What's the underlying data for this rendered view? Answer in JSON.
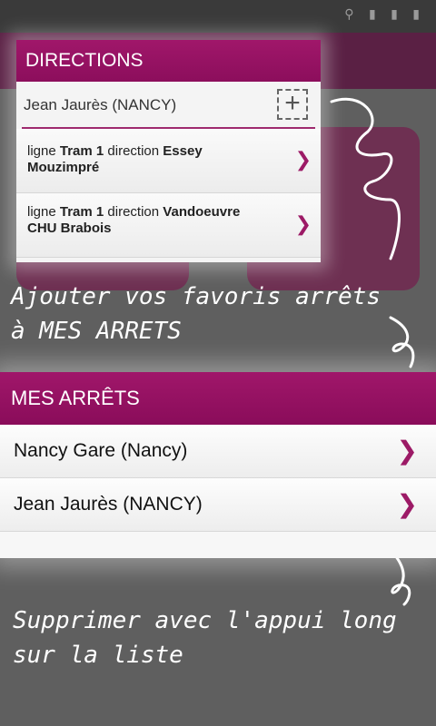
{
  "directions": {
    "title": "DIRECTIONS",
    "stop": "Jean Jaurès (NANCY)",
    "add_symbol": "+",
    "routes": [
      {
        "prefix": "ligne",
        "line": "Tram 1",
        "mid": "direction",
        "destination": "Essey Mouzimpré"
      },
      {
        "prefix": "ligne",
        "line": "Tram 1",
        "mid": "direction",
        "destination": "Vandoeuvre CHU Brabois"
      }
    ]
  },
  "annotations": {
    "add_favorites": "Ajouter vos favoris arrêts\nà MES ARRETS",
    "delete_hint": "Supprimer avec l'appui long\nsur la liste"
  },
  "mes_arrets": {
    "title": "MES ARRÊTS",
    "items": [
      {
        "label": "Nancy Gare (Nancy)"
      },
      {
        "label": "Jean Jaurès (NANCY)"
      }
    ]
  },
  "icons": {
    "chevron": "chevron-right-icon",
    "add": "add-box-icon"
  },
  "colors": {
    "accent": "#9c1a66",
    "overlay": "#5f5f5f"
  }
}
